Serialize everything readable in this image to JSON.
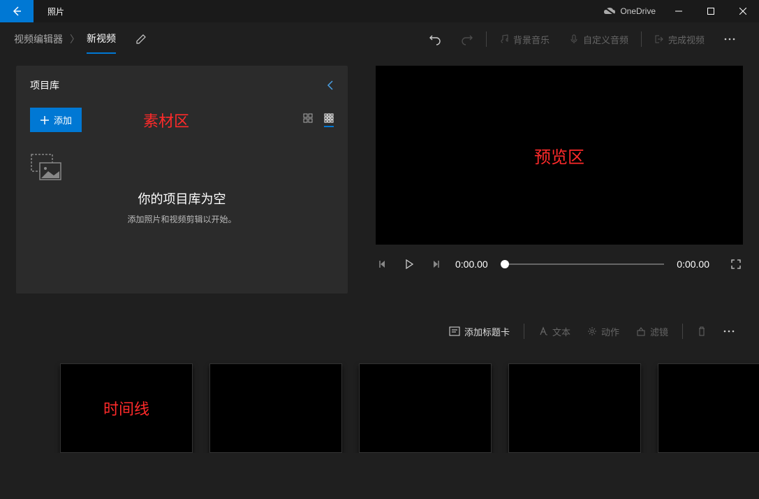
{
  "titlebar": {
    "app_name": "照片",
    "onedrive": "OneDrive"
  },
  "breadcrumb": {
    "root": "视频编辑器",
    "current": "新视频"
  },
  "header_actions": {
    "bg_music": "背景音乐",
    "custom_audio": "自定义音频",
    "finish": "完成视频"
  },
  "library": {
    "title": "项目库",
    "add": "添加",
    "empty_title": "你的项目库为空",
    "empty_sub": "添加照片和视频剪辑以开始。"
  },
  "player": {
    "current": "0:00.00",
    "total": "0:00.00"
  },
  "timeline_toolbar": {
    "title_card": "添加标题卡",
    "text": "文本",
    "motion": "动作",
    "filter": "滤镜"
  },
  "annotations": {
    "material": "素材区",
    "preview": "预览区",
    "timeline": "时间线"
  }
}
